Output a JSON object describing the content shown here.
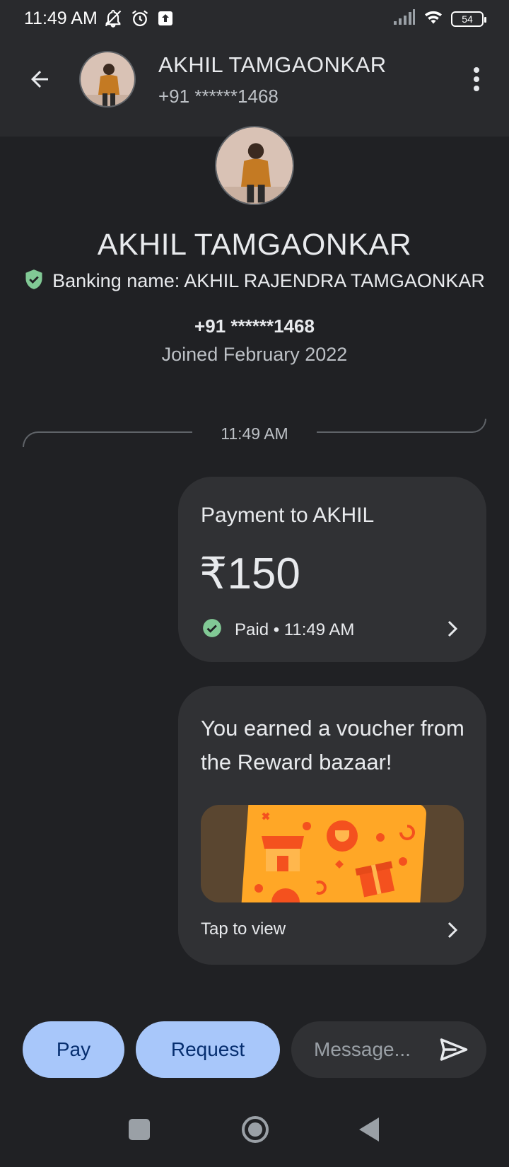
{
  "status_bar": {
    "time": "11:49 AM",
    "battery": "54",
    "icons": [
      "notifications-off-icon",
      "alarm-icon",
      "upload-icon",
      "signal-icon",
      "wifi-icon",
      "battery-icon"
    ]
  },
  "header": {
    "name": "AKHIL TAMGAONKAR",
    "phone": "+91 ******1468"
  },
  "profile": {
    "name": "AKHIL TAMGAONKAR",
    "banking_name": "Banking name: AKHIL RAJENDRA TAMGAONKAR",
    "phone": "+91 ******1468",
    "joined": "Joined February 2022"
  },
  "conversation": {
    "timestamp": "11:49 AM",
    "payment": {
      "title": "Payment to AKHIL",
      "amount": "₹150",
      "status": "Paid • 11:49 AM"
    },
    "voucher": {
      "title": "You earned a voucher from the Reward bazaar!",
      "action": "Tap to view"
    }
  },
  "composer": {
    "pay_label": "Pay",
    "request_label": "Request",
    "message_placeholder": "Message..."
  },
  "colors": {
    "background": "#202124",
    "app_bar": "#292a2d",
    "card": "#303134",
    "accent_button": "#a8c7fa",
    "success": "#81c995",
    "voucher_orange": "#ffa726"
  }
}
